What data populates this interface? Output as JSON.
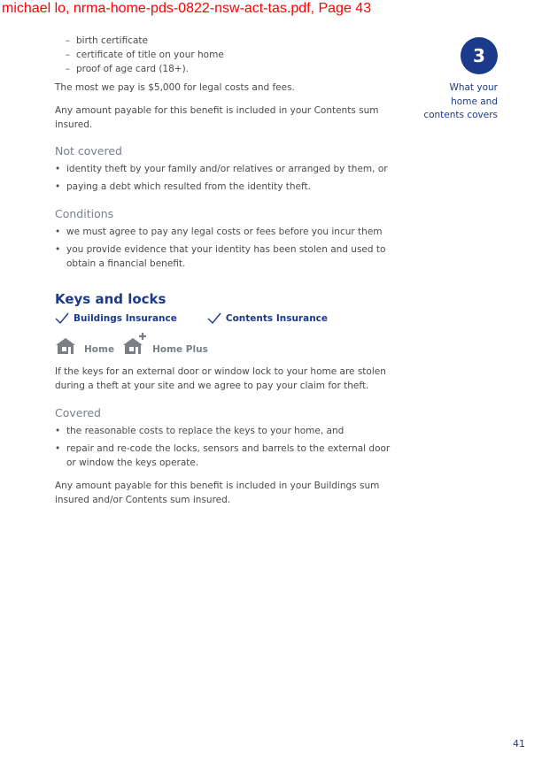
{
  "header": {
    "text": "michael lo, nrma-home-pds-0822-nsw-act-tas.pdf, Page 43"
  },
  "top_list": [
    "birth certificate",
    "certificate of title on your home",
    "proof of age card (18+)."
  ],
  "paragraphs": {
    "max_pay": "The most we pay is $5,000 for legal costs and fees.",
    "contents_sum": "Any amount payable for this benefit is included in your Contents sum insured."
  },
  "not_covered": {
    "heading": "Not covered",
    "items": [
      "identity theft by your family and/or relatives or arranged by them, or",
      "paying a debt which resulted from the identity theft."
    ]
  },
  "conditions": {
    "heading": "Conditions",
    "items": [
      "we must agree to pay any legal costs or fees before you incur them",
      "you provide evidence that your identity has been stolen and used to obtain a financial benefit."
    ]
  },
  "keys": {
    "heading": "Keys and locks",
    "covers": [
      "Buildings Insurance",
      "Contents Insurance"
    ],
    "products": [
      "Home",
      "Home Plus"
    ],
    "intro": "If the keys for an external door or window lock to your home are stolen during a theft at your site and we agree to pay your claim for theft.",
    "covered_heading": "Covered",
    "covered_items": [
      "the reasonable costs to replace the keys to your home, and",
      "repair and re-code the locks, sensors and barrels to the external door or window the keys operate."
    ],
    "sum_insured": "Any amount payable for this benefit is included in your Buildings sum insured and/or Contents sum insured."
  },
  "sidebar": {
    "chapter": "3",
    "label": "What your\nhome and\ncontents covers"
  },
  "page_number": "41",
  "colors": {
    "brand": "#1b3a8c",
    "body_text": "#4a4a4a",
    "subheading": "#7a7f87",
    "header": "#ff0000"
  }
}
